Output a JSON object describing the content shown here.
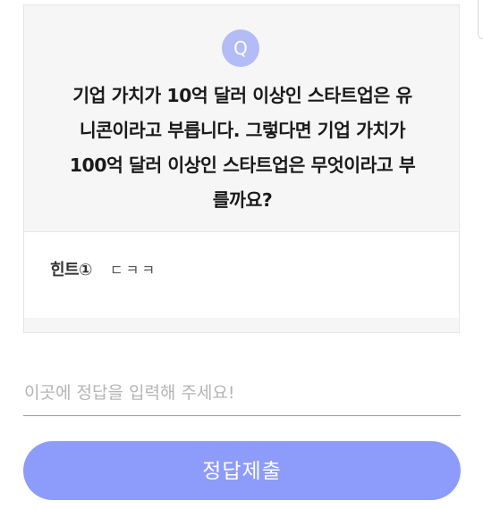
{
  "question": {
    "badge": "Q",
    "line1": "기업 가치가 10억 달러 이상인 스타트업은 유",
    "line2": "니콘이라고 부릅니다. 그렇다면 기업 가치가",
    "line3": "100억 달러 이상인 스타트업은 무엇이라고 부",
    "line4": "를까요?"
  },
  "hint": {
    "label": "힌트①",
    "value": "ㄷㅋㅋ"
  },
  "answer": {
    "placeholder": "이곳에 정답을 입력해 주세요!",
    "value": ""
  },
  "submit": {
    "label": "정답제출"
  },
  "colors": {
    "accent": "#8d9bfa",
    "badge": "#b3bcf7",
    "highlight": "#f8d36b",
    "question_bg": "#f6f6f6"
  }
}
